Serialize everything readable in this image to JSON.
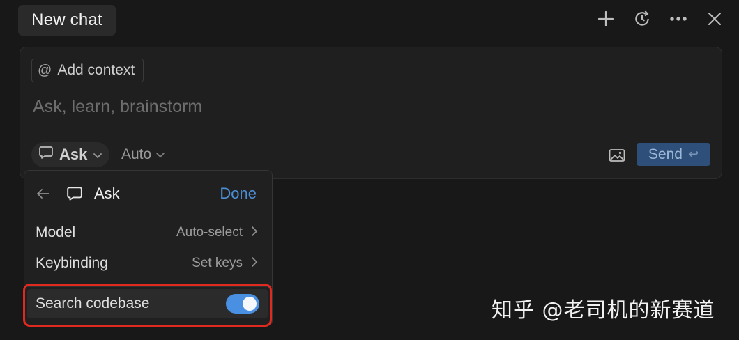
{
  "header": {
    "tab_title": "New chat",
    "actions": [
      {
        "name": "plus-icon"
      },
      {
        "name": "history-icon"
      },
      {
        "name": "more-icon"
      },
      {
        "name": "close-icon"
      }
    ]
  },
  "composer": {
    "add_context_icon": "at-icon",
    "add_context_label": "Add context",
    "input_placeholder": "Ask, learn, brainstorm",
    "input_value": "",
    "mode_label": "Ask",
    "model_label": "Auto",
    "send_label": "Send",
    "send_key_glyph": "↩"
  },
  "menu": {
    "title": "Ask",
    "done_label": "Done",
    "rows": [
      {
        "label": "Model",
        "value": "Auto-select"
      },
      {
        "label": "Keybinding",
        "value": "Set keys"
      }
    ],
    "toggle_row": {
      "label": "Search codebase",
      "enabled": true
    }
  },
  "colors": {
    "accent": "#4a90e2",
    "highlight": "#e0291f",
    "send_bg": "#2e4f7a"
  },
  "watermark": "知乎 @老司机的新赛道"
}
